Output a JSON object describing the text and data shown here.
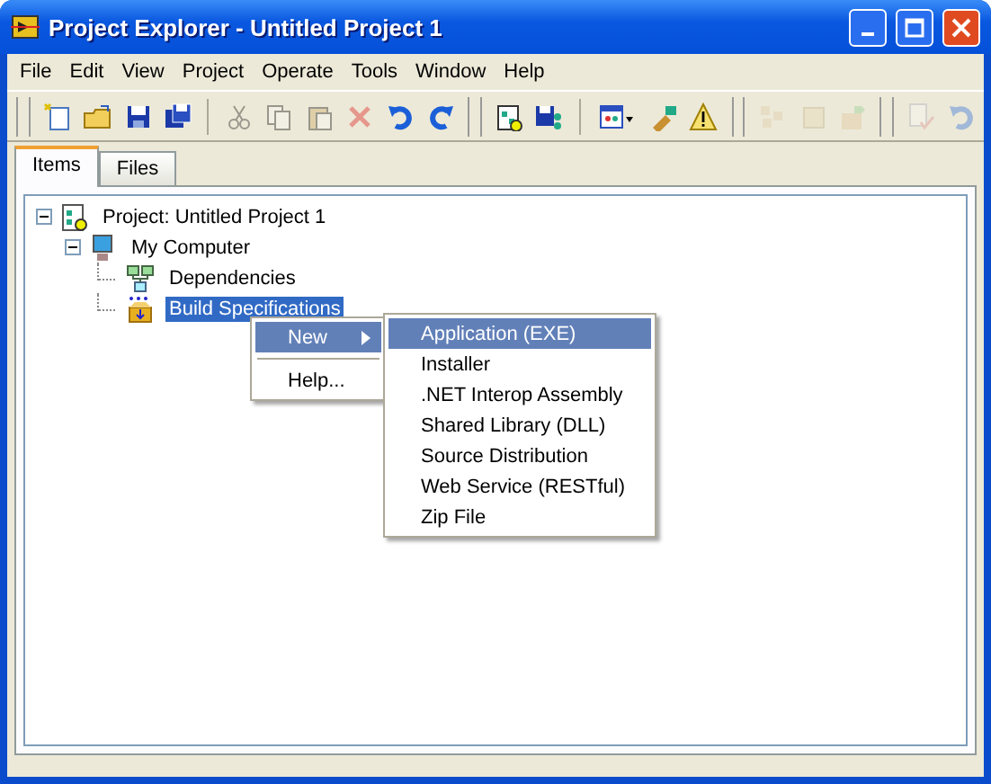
{
  "window": {
    "title": "Project Explorer - Untitled Project 1"
  },
  "menu_bar": [
    "File",
    "Edit",
    "View",
    "Project",
    "Operate",
    "Tools",
    "Window",
    "Help"
  ],
  "toolbar": [
    {
      "kind": "new",
      "disabled": false
    },
    {
      "kind": "open",
      "disabled": false
    },
    {
      "kind": "save",
      "disabled": false
    },
    {
      "kind": "saveall",
      "disabled": false
    },
    {
      "kind": "sep"
    },
    {
      "kind": "cut",
      "disabled": true
    },
    {
      "kind": "copy",
      "disabled": true
    },
    {
      "kind": "paste",
      "disabled": true
    },
    {
      "kind": "delete",
      "disabled": true
    },
    {
      "kind": "undo",
      "disabled": false
    },
    {
      "kind": "redo",
      "disabled": false
    },
    {
      "kind": "grip"
    },
    {
      "kind": "build",
      "disabled": false
    },
    {
      "kind": "savebuild",
      "disabled": false
    },
    {
      "kind": "sep"
    },
    {
      "kind": "view",
      "disabled": false
    },
    {
      "kind": "tool",
      "disabled": false
    },
    {
      "kind": "warning",
      "disabled": false
    },
    {
      "kind": "grip"
    },
    {
      "kind": "boxes",
      "disabled": true
    },
    {
      "kind": "box",
      "disabled": true
    },
    {
      "kind": "boxarrow",
      "disabled": true
    },
    {
      "kind": "grip"
    },
    {
      "kind": "check",
      "disabled": true
    },
    {
      "kind": "undo",
      "disabled": true
    }
  ],
  "tabs": [
    {
      "label": "Items",
      "selected": true
    },
    {
      "label": "Files",
      "selected": false
    }
  ],
  "tree": [
    {
      "label": "Project: Untitled Project 1",
      "kind": "project",
      "expanded": true,
      "selected": false,
      "children": [
        {
          "label": "My Computer",
          "kind": "computer",
          "expanded": true,
          "selected": false,
          "children": [
            {
              "label": "Dependencies",
              "kind": "dependencies",
              "selected": false
            },
            {
              "label": "Build Specifications",
              "kind": "build",
              "selected": true
            }
          ]
        }
      ]
    }
  ],
  "context_menu": {
    "items": [
      {
        "kind": "submenu",
        "label": "New",
        "selected": true
      },
      {
        "kind": "separator"
      },
      {
        "kind": "item",
        "label": "Help...",
        "selected": false
      }
    ]
  },
  "submenu": {
    "items": [
      {
        "label": "Application (EXE)",
        "selected": true
      },
      {
        "label": "Installer",
        "selected": false
      },
      {
        "label": ".NET Interop Assembly",
        "selected": false
      },
      {
        "label": "Shared Library (DLL)",
        "selected": false
      },
      {
        "label": "Source Distribution",
        "selected": false
      },
      {
        "label": "Web Service (RESTful)",
        "selected": false
      },
      {
        "label": "Zip File",
        "selected": false
      }
    ]
  }
}
